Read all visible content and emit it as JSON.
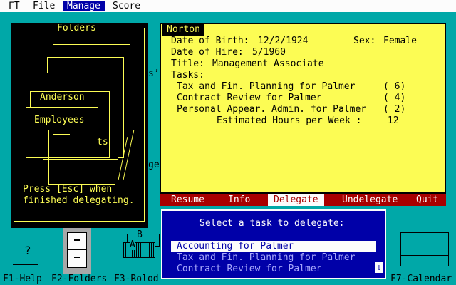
{
  "menubar": {
    "logo": "ΓT",
    "items": [
      {
        "label": "File",
        "active": false
      },
      {
        "label": "Manage",
        "active": true
      },
      {
        "label": "Score",
        "active": false
      }
    ]
  },
  "folders_panel": {
    "title": "Folders",
    "folder_labels": [
      "Anderson",
      "Employees",
      "ts"
    ],
    "instructions_line1": "Press [Esc] when",
    "instructions_line2": "finished delegating."
  },
  "background_window": {
    "partial_1": "s’",
    "partial_2": "ge"
  },
  "employee": {
    "name": "Norton",
    "dob_label": "Date of Birth:",
    "dob": "12/2/1924",
    "sex_label": "Sex:",
    "sex": "Female",
    "hire_label": "Date of Hire:",
    "hire": "5/1960",
    "title_label": "Title:",
    "title": "Management Associate",
    "tasks_label": "Tasks:",
    "tasks": [
      {
        "name": "Tax and Fin. Planning for Palmer",
        "hours": "( 6)"
      },
      {
        "name": "Contract Review for Palmer",
        "hours": "( 4)"
      },
      {
        "name": "Personal Appear. Admin. for Palmer",
        "hours": "( 2)"
      }
    ],
    "est_label": "Estimated Hours per Week :",
    "est_value": "12"
  },
  "actions": [
    "Resume",
    "Info",
    "Delegate",
    "Undelegate",
    "Quit"
  ],
  "selected_action": "Delegate",
  "dialog": {
    "prompt": "Select a task to delegate:",
    "options": [
      "Accounting for Palmer",
      "Tax and Fin. Planning for Palmer",
      "Contract Review for Palmer"
    ],
    "scroll_glyph": "⇓"
  },
  "function_keys": [
    {
      "key": "F1-Help"
    },
    {
      "key": "F2-Folders"
    },
    {
      "key": "F3-Rolod"
    },
    {
      "key": "F7-Calendar"
    }
  ],
  "rolodex_letters": [
    "B",
    "A"
  ],
  "help_glyph": "?",
  "colors": {
    "background": "#00a8a8",
    "menubar": "#fcfcfc",
    "menu_active": "#0000a8",
    "panel_yellow": "#fcfc54",
    "action_bar": "#a80000",
    "dialog": "#0000a8"
  }
}
